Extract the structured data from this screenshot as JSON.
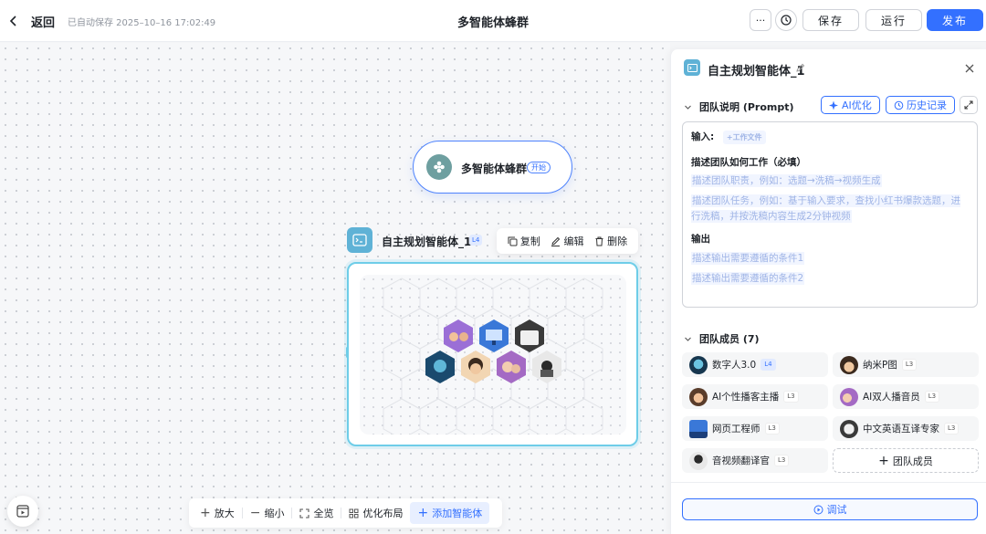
{
  "header": {
    "back_label": "返回",
    "autosave": "已自动保存 2025–10–16 17:02:49",
    "title": "多智能体蜂群",
    "more_glyph": "···",
    "save_label": "保存",
    "run_label": "运行",
    "publish_label": "发布"
  },
  "canvas": {
    "start_node": {
      "label": "多智能体蜂群",
      "tag": "开始"
    },
    "agent_node": {
      "name": "自主规划智能体_1",
      "level": "L4"
    },
    "node_toolbar": {
      "copy": "复制",
      "edit": "编辑",
      "delete": "删除"
    },
    "bottom_toolbar": {
      "zoom_in": "放大",
      "zoom_out": "缩小",
      "fit": "全览",
      "layout": "优化布局",
      "add_agent": "添加智能体"
    }
  },
  "panel": {
    "title": "自主规划智能体_1",
    "team_desc": {
      "header": "团队说明 (Prompt)",
      "ai_optimize": "AI优化",
      "history": "历史记录",
      "input_label": "输入:",
      "input_chip": "+工作文件",
      "work_heading": "描述团队如何工作（必填）",
      "ph1": "描述团队职责，例如：选题→洗稿→视频生成",
      "ph2": "描述团队任务，例如：基于输入要求，查找小红书爆款选题，进行洗稿，并按洗稿内容生成2分钟视频",
      "output_heading": "输出",
      "ph3": "描述输出需要遵循的条件1",
      "ph4": "描述输出需要遵循的条件2"
    },
    "members": {
      "header": "团队成员 (7)",
      "items": [
        {
          "name": "数字人3.0",
          "level": "L4"
        },
        {
          "name": "纳米P图",
          "level": "L3"
        },
        {
          "name": "AI个性播客主播",
          "level": "L3"
        },
        {
          "name": "AI双人播音员",
          "level": "L3"
        },
        {
          "name": "网页工程师",
          "level": "L3"
        },
        {
          "name": "中文英语互译专家",
          "level": "L3"
        },
        {
          "name": "音视频翻译官",
          "level": "L3"
        }
      ],
      "add_label": "团队成员"
    },
    "debug_label": "调试"
  },
  "colors": {
    "accent": "#3370ff",
    "node_border": "#6ecde8",
    "agent_icon": "#5fb2d6"
  }
}
